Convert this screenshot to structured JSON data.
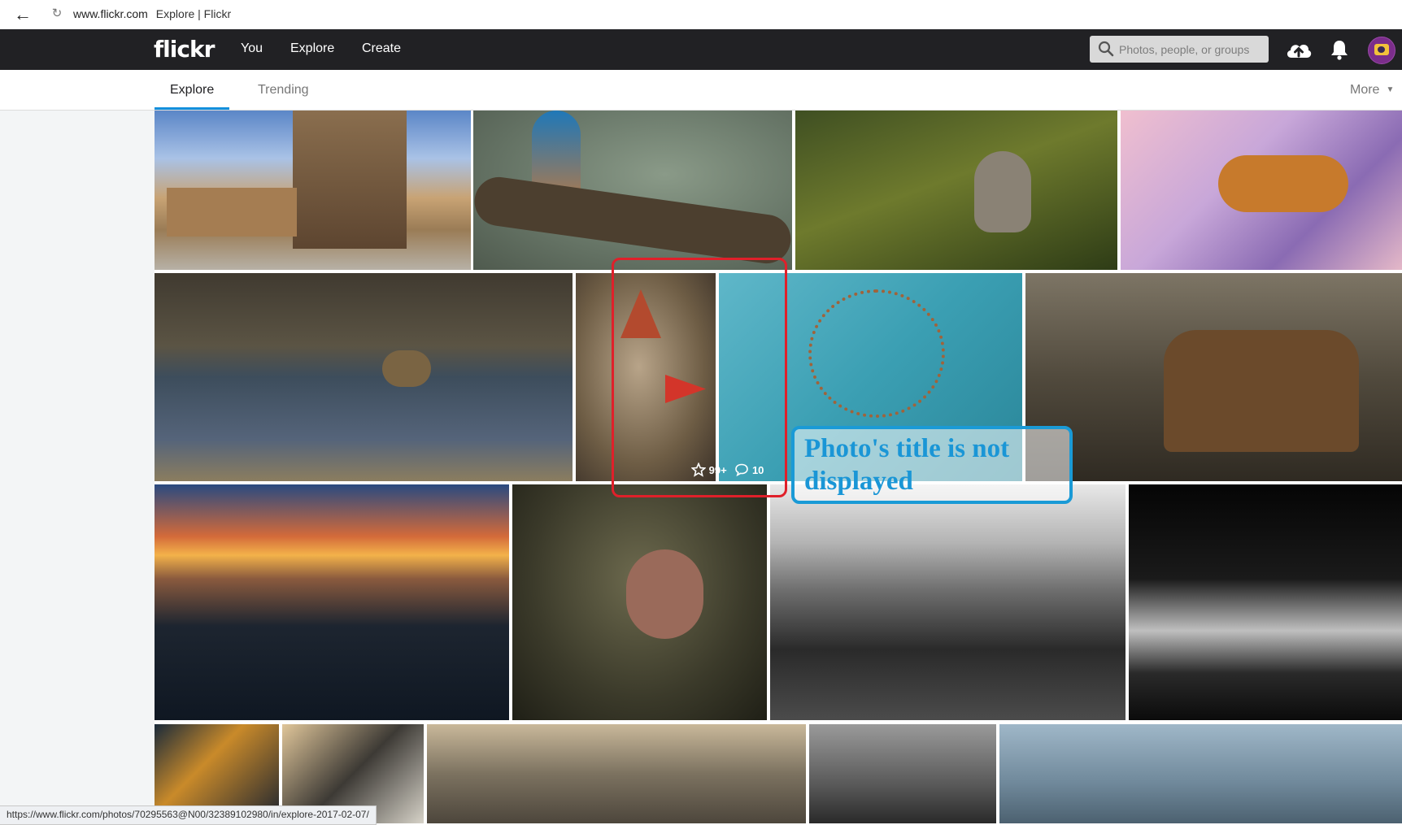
{
  "browser": {
    "back_icon": "arrow-left-icon",
    "reload_icon": "reload-icon",
    "url": "www.flickr.com",
    "page_title": "Explore | Flickr"
  },
  "header": {
    "logo": "flickr",
    "nav": [
      "You",
      "Explore",
      "Create"
    ],
    "search_placeholder": "Photos, people, or groups",
    "upload_icon": "cloud-upload-icon",
    "notifications_icon": "bell-icon"
  },
  "subnav": {
    "tabs": [
      "Explore",
      "Trending"
    ],
    "active_tab": "Explore",
    "more_label": "More"
  },
  "highlighted_photo": {
    "favorites": "99+",
    "comments": "10"
  },
  "annotation": {
    "text": "Photo's title is not displayed",
    "box_color": "#1a9ad6",
    "highlight_color": "#e0202a"
  },
  "status_bar": {
    "link": "https://www.flickr.com/photos/70295563@N00/32389102980/in/explore-2017-02-07/"
  },
  "colors": {
    "header_bg": "#212124",
    "active_tab_underline": "#128fdc"
  }
}
